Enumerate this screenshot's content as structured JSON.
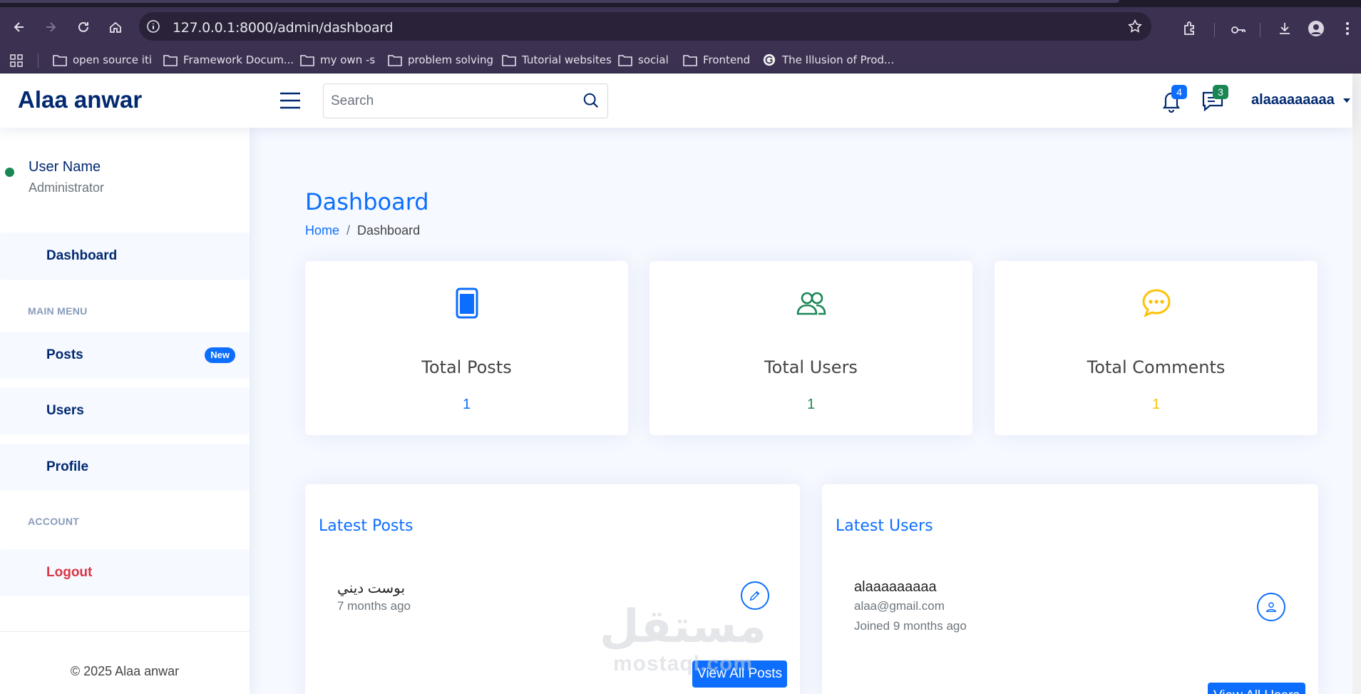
{
  "browser": {
    "url": "127.0.0.1:8000/admin/dashboard",
    "bookmarks": [
      {
        "label": "open  source iti",
        "icon": "folder-icon"
      },
      {
        "label": "Framework Docum...",
        "icon": "folder-icon"
      },
      {
        "label": "my own -s",
        "icon": "folder-icon"
      },
      {
        "label": "problem solving",
        "icon": "folder-icon"
      },
      {
        "label": "Tutorial websites",
        "icon": "folder-icon"
      },
      {
        "label": "social",
        "icon": "folder-icon"
      },
      {
        "label": "Frontend",
        "icon": "folder-icon"
      },
      {
        "label": "The Illusion of Prod...",
        "icon": "grammarly-icon"
      }
    ]
  },
  "header": {
    "brand": "Alaa anwar",
    "search_placeholder": "Search",
    "notifications_count": "4",
    "messages_count": "3",
    "username": "alaaaaaaaaa"
  },
  "sidebar": {
    "profile_name": "User Name",
    "profile_role": "Administrator",
    "dashboard_label": "Dashboard",
    "main_menu_heading": "MAIN MENU",
    "posts_label": "Posts",
    "posts_badge": "New",
    "users_label": "Users",
    "profile_label": "Profile",
    "account_heading": "ACCOUNT",
    "logout_label": "Logout",
    "footer": "© 2025 Alaa anwar"
  },
  "main": {
    "title": "Dashboard",
    "breadcrumb_home": "Home",
    "breadcrumb_sep": "/",
    "breadcrumb_current": "Dashboard",
    "stats": [
      {
        "label": "Total Posts",
        "value": "1",
        "color": "#0d6efd",
        "icon": "phone-icon"
      },
      {
        "label": "Total Users",
        "value": "1",
        "color": "#198754",
        "icon": "people-icon"
      },
      {
        "label": "Total Comments",
        "value": "1",
        "color": "#ffc107",
        "icon": "chat-dots-icon"
      }
    ],
    "latest_posts": {
      "title": "Latest Posts",
      "post_title": "بوست ديني",
      "post_time": "7 months ago",
      "view_all": "View All Posts"
    },
    "latest_users": {
      "title": "Latest Users",
      "user_name": "alaaaaaaaaa",
      "user_email": "alaa@gmail.com",
      "user_joined": "Joined 9 months ago",
      "view_all": "View All Users"
    }
  },
  "watermark": {
    "arabic": "مستقل",
    "latin": "mostaql.com"
  },
  "colors": {
    "primary": "#0d6efd",
    "brand": "#012970",
    "success": "#198754",
    "warning": "#ffc107",
    "danger": "#dc3545"
  }
}
